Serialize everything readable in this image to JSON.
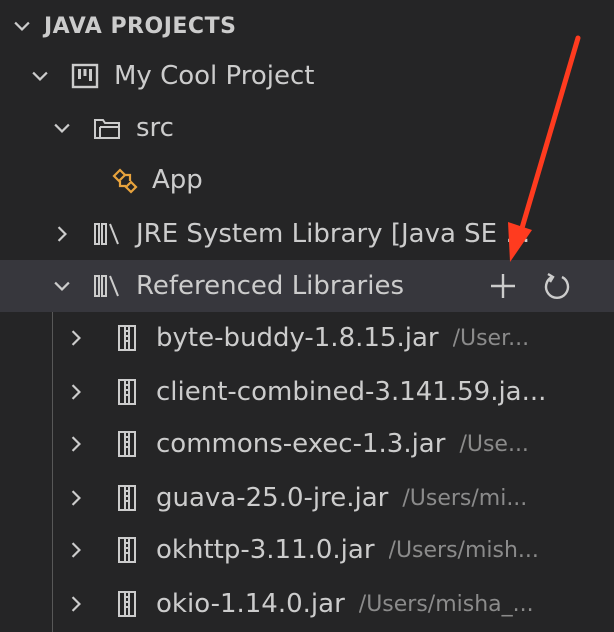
{
  "section": {
    "title": "JAVA PROJECTS"
  },
  "tree": {
    "project": {
      "label": "My Cool Project"
    },
    "src": {
      "label": "src"
    },
    "app": {
      "label": "App"
    },
    "jre": {
      "label": "JRE System Library [Java SE ..."
    },
    "ref": {
      "label": "Referenced Libraries",
      "add_tooltip_icon": "plus-icon",
      "refresh_icon": "refresh-icon"
    },
    "jars": [
      {
        "label": "byte-buddy-1.8.15.jar",
        "path": "/User..."
      },
      {
        "label": "client-combined-3.141.59.ja...",
        "path": ""
      },
      {
        "label": "commons-exec-1.3.jar",
        "path": "/Use..."
      },
      {
        "label": "guava-25.0-jre.jar",
        "path": "/Users/mi..."
      },
      {
        "label": "okhttp-3.11.0.jar",
        "path": "/Users/mish..."
      },
      {
        "label": "okio-1.14.0.jar",
        "path": "/Users/misha_..."
      }
    ]
  },
  "colors": {
    "background": "#252526",
    "selected_row": "#37373d",
    "text": "#cccccc",
    "description": "#8b8b8b",
    "class_icon": "#e8a33d",
    "annotation_arrow": "#ff3b1f"
  }
}
